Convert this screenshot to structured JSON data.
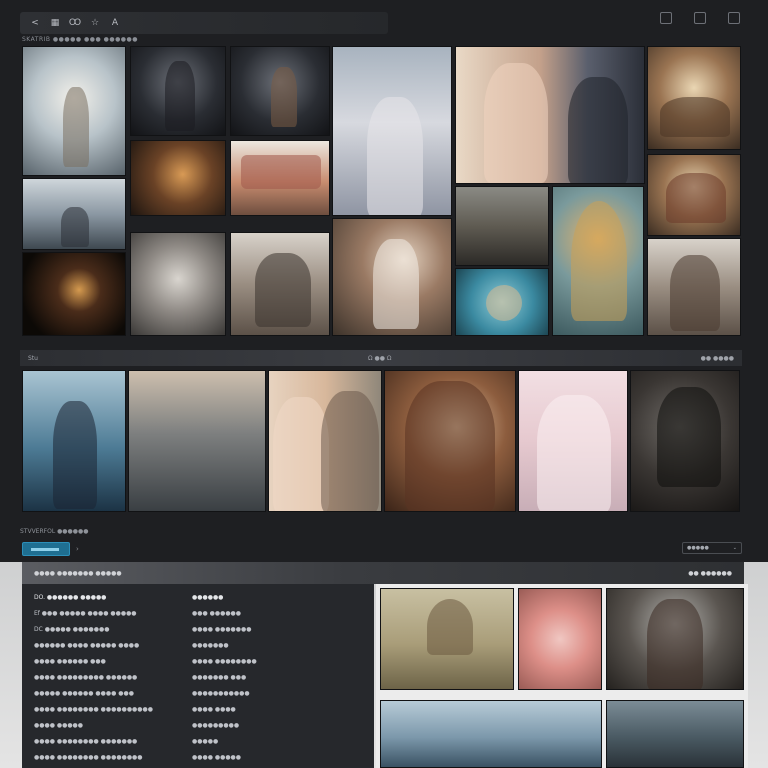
{
  "toolbar": {
    "left_icons": [
      "back-icon",
      "grid-icon",
      "image-icon",
      "star-icon",
      "text-icon"
    ],
    "left_glyphs": [
      "<",
      "▦",
      "Ꝏ",
      "☆",
      "A"
    ],
    "right_icons": [
      "page-icon",
      "filter-icon",
      "share-icon"
    ]
  },
  "breadcrumb": "SKATRIB ●●●●● ●●● ●●●●●●",
  "gallery_top": {
    "tiles": [
      "",
      "",
      "",
      "",
      "",
      "",
      "",
      "",
      "",
      "",
      "",
      "",
      "",
      "",
      "",
      "",
      "",
      "",
      "",
      ""
    ]
  },
  "section_bar": {
    "left": "Stu",
    "center": "Ω ●● Ω",
    "right": "●● ●●●●"
  },
  "gallery_mid": {
    "tiles": [
      "",
      "",
      "",
      "",
      "",
      "",
      ""
    ]
  },
  "controls": {
    "title": "STVVERFOL ●●●●●●",
    "chevron": "›",
    "sort_label": "●●●●●",
    "sort_arrow": "⌄"
  },
  "detail": {
    "header_left": "●●●● ●●●●●●● ●●●●●",
    "header_right": "●● ●●●●●●",
    "left_col": [
      {
        "text": "DO. ●●●●●● ●●●●●",
        "strong": true
      },
      {
        "text": "Ef ●●● ●●●●● ●●●● ●●●●●",
        "strong": false
      },
      {
        "text": "DC ●●●●● ●●●●●●●",
        "strong": false
      },
      {
        "text": "●●●●●● ●●●● ●●●●● ●●●●",
        "strong": false
      },
      {
        "text": "●●●● ●●●●●● ●●●",
        "strong": false
      },
      {
        "text": "●●●● ●●●●●●●●● ●●●●●●",
        "strong": false
      },
      {
        "text": "●●●●● ●●●●●● ●●●● ●●●",
        "strong": false
      },
      {
        "text": "●●●● ●●●●●●●● ●●●●●●●●●●",
        "strong": false
      },
      {
        "text": "●●●● ●●●●●",
        "strong": false
      },
      {
        "text": "●●●● ●●●●●●●● ●●●●●●●",
        "strong": false
      },
      {
        "text": "●●●● ●●●●●●●● ●●●●●●●●",
        "strong": false
      },
      {
        "text": "●●●●●● ●●●●●●",
        "strong": false
      }
    ],
    "right_col": [
      {
        "text": "●●●●●●",
        "strong": true
      },
      {
        "text": "●●● ●●●●●●",
        "strong": false
      },
      {
        "text": "●●●● ●●●●●●●",
        "strong": false
      },
      {
        "text": "●●●●●●●",
        "strong": false
      },
      {
        "text": "●●●● ●●●●●●●●",
        "strong": false
      },
      {
        "text": "●●●●●●● ●●●",
        "strong": false
      },
      {
        "text": "●●●●●●●●●●●",
        "strong": false
      },
      {
        "text": "●●●● ●●●●",
        "strong": false
      },
      {
        "text": "●●●●●●●●●",
        "strong": false
      },
      {
        "text": "●●●●●",
        "strong": false
      },
      {
        "text": "●●●● ●●●●●",
        "strong": false
      },
      {
        "text": "●●●●●●●●",
        "strong": false
      }
    ]
  },
  "bottom_tiles": [
    "",
    "",
    "",
    "",
    ""
  ]
}
